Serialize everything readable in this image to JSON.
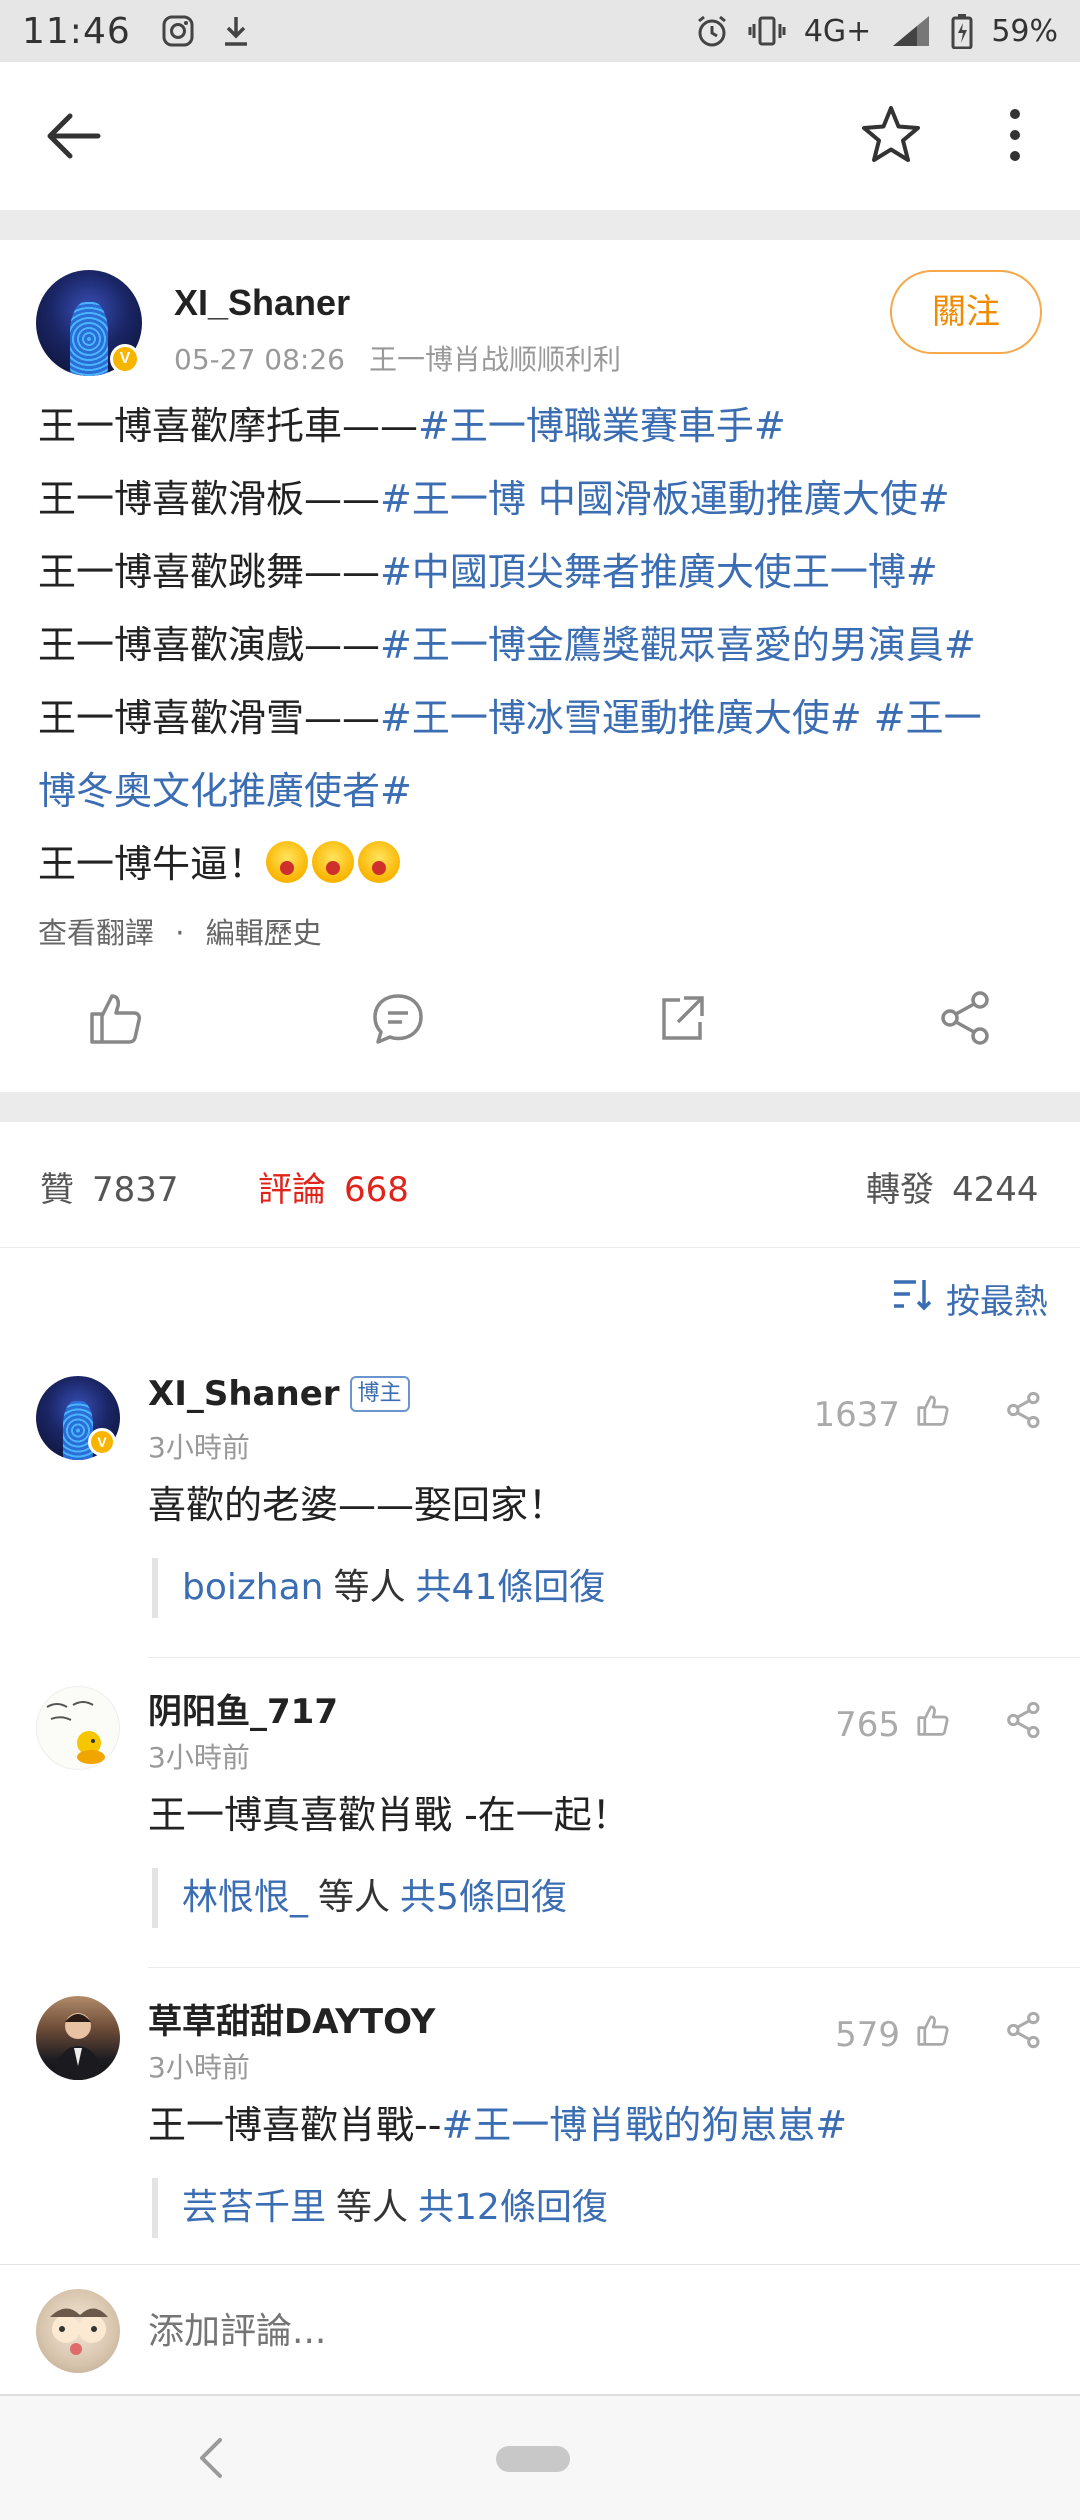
{
  "status_bar": {
    "time": "11:46",
    "network": "4G+",
    "battery": "59%",
    "icons": [
      "instagram-icon",
      "download-icon",
      "alarm-icon",
      "vibrate-icon",
      "signal-icon",
      "battery-icon"
    ]
  },
  "nav": {
    "icons": [
      "back-arrow-icon",
      "star-icon",
      "more-vertical-icon"
    ]
  },
  "post": {
    "author": "XI_Shaner",
    "verified_badge": "V",
    "date": "05-27 08:26",
    "source": "王一博肖战顺顺利利",
    "follow_label": "關注",
    "lines": [
      {
        "text": "王一博喜歡摩托車——",
        "tag": "#王一博職業賽車手#"
      },
      {
        "text": "王一博喜歡滑板——",
        "tag": "#王一博 中國滑板運動推廣大使#"
      },
      {
        "text": "王一博喜歡跳舞——",
        "tag": "#中國頂尖舞者推廣大使王一博#"
      },
      {
        "text": "王一博喜歡演戲——",
        "tag": "#王一博金鷹獎觀眾喜愛的男演員#"
      },
      {
        "text": "王一博喜歡滑雪——",
        "tag": "#王一博冰雪運動推廣大使# #王一"
      },
      {
        "text": "",
        "tag": "博冬奧文化推廣使者#"
      }
    ],
    "closing": "王一博牛逼！",
    "links": {
      "translate": "查看翻譯",
      "dot": "·",
      "history": "編輯歷史"
    },
    "action_icons": [
      "like-icon",
      "comment-icon",
      "repost-icon",
      "share-icon"
    ]
  },
  "stats": {
    "likes_label": "贊",
    "likes": "7837",
    "comments_label": "評論",
    "comments": "668",
    "reposts_label": "轉發",
    "reposts": "4244",
    "active_color": "#e0241b"
  },
  "sort": {
    "label": "按最熱",
    "icon": "sort-icon"
  },
  "comments": [
    {
      "user": "XI_Shaner",
      "badge": "博主",
      "time": "3小時前",
      "likes": "1637",
      "text": "喜歡的老婆——娶回家！",
      "tag": "",
      "reply_user": "boizhan",
      "reply_mid": "等人",
      "reply_count": "共41條回復"
    },
    {
      "user": "阴阳鱼_717",
      "badge": "",
      "time": "3小時前",
      "likes": "765",
      "text": "王一博真喜歡肖戰 -在一起！",
      "tag": "",
      "reply_user": "林恨恨_",
      "reply_mid": "等人",
      "reply_count": "共5條回復"
    },
    {
      "user": "草草甜甜DAYTOY",
      "badge": "",
      "time": "3小時前",
      "likes": "579",
      "text": "王一博喜歡肖戰--",
      "tag": "#王一博肖戰的狗崽崽#",
      "reply_user": "芸苔千里",
      "reply_mid": "等人",
      "reply_count": "共12條回復"
    }
  ],
  "add_comment": {
    "placeholder": "添加評論..."
  },
  "colors": {
    "link": "#3b6db3",
    "follow": "#f08a00",
    "muted": "#999999"
  }
}
